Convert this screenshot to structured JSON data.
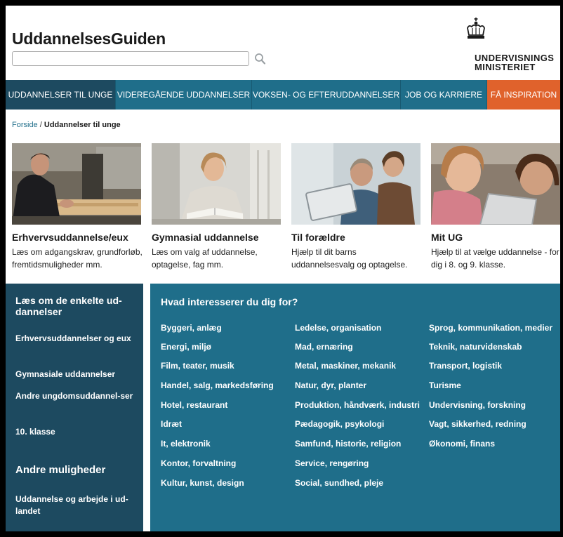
{
  "header": {
    "site_title": "UddannelsesGuiden",
    "search_value": "",
    "ministry_line1": "UNDERVISNINGS",
    "ministry_line2": "MINISTERIET"
  },
  "nav": [
    "UDDANNELSER TIL UNGE",
    "VIDEREGÅENDE UDDANNELSER",
    "VOKSEN- OG EFTERUDDANNELSER",
    "JOB OG KARRIERE",
    "FÅ INSPIRATION"
  ],
  "breadcrumb": {
    "home": "Forside",
    "separator": "/",
    "current": "Uddannelser til unge"
  },
  "cards": [
    {
      "title": "Erhvervsuddannelse/eux",
      "desc": "Læs om adgangskrav, grundforløb, fremtidsmuligheder mm."
    },
    {
      "title": "Gymnasial uddannelse",
      "desc": "Læs om valg af uddannelse, optagelse, fag mm."
    },
    {
      "title": "Til forældre",
      "desc": "Hjælp til dit barns uddannelsesvalg og optagelse."
    },
    {
      "title": "Mit UG",
      "desc": "Hjælp til at vælge uddannelse - for dig i 8. og 9. klasse."
    }
  ],
  "left_panel": {
    "heading": "Læs om de enkelte ud-dannelser",
    "links": [
      "Erhvervsuddannelser og eux",
      "Gymnasiale uddannelser",
      "Andre ungdomsuddannel-ser",
      "10. klasse"
    ],
    "heading2": "Andre muligheder",
    "links2": [
      "Uddannelse og arbejde i ud-landet"
    ]
  },
  "interests": {
    "heading": "Hvad interesserer du dig for?",
    "col1": [
      "Byggeri, anlæg",
      "Energi, miljø",
      "Film, teater, musik",
      "Handel, salg, markedsføring",
      "Hotel, restaurant",
      "Idræt",
      "It, elektronik",
      "Kontor, forvaltning",
      "Kultur, kunst, design"
    ],
    "col2": [
      "Ledelse, organisation",
      "Mad, ernæring",
      "Metal, maskiner, mekanik",
      "Natur, dyr, planter",
      "Produktion, håndværk, industri",
      "Pædagogik, psykologi",
      "Samfund, historie, religion",
      "Service, rengøring",
      "Social, sundhed, pleje"
    ],
    "col3": [
      "Sprog, kommunikation, medier",
      "Teknik, naturvidenskab",
      "Transport, logistik",
      "Turisme",
      "Undervisning, forskning",
      "Vagt, sikkerhed, redning",
      "Økonomi, finans"
    ]
  },
  "colors": {
    "nav_bg": "#1f6e8a",
    "nav_active": "#1d4a60",
    "nav_orange": "#e0622c",
    "panel_dark": "#1d4a60",
    "panel_teal": "#1f6e8a"
  },
  "icons": [
    "search-icon",
    "crown-icon"
  ]
}
